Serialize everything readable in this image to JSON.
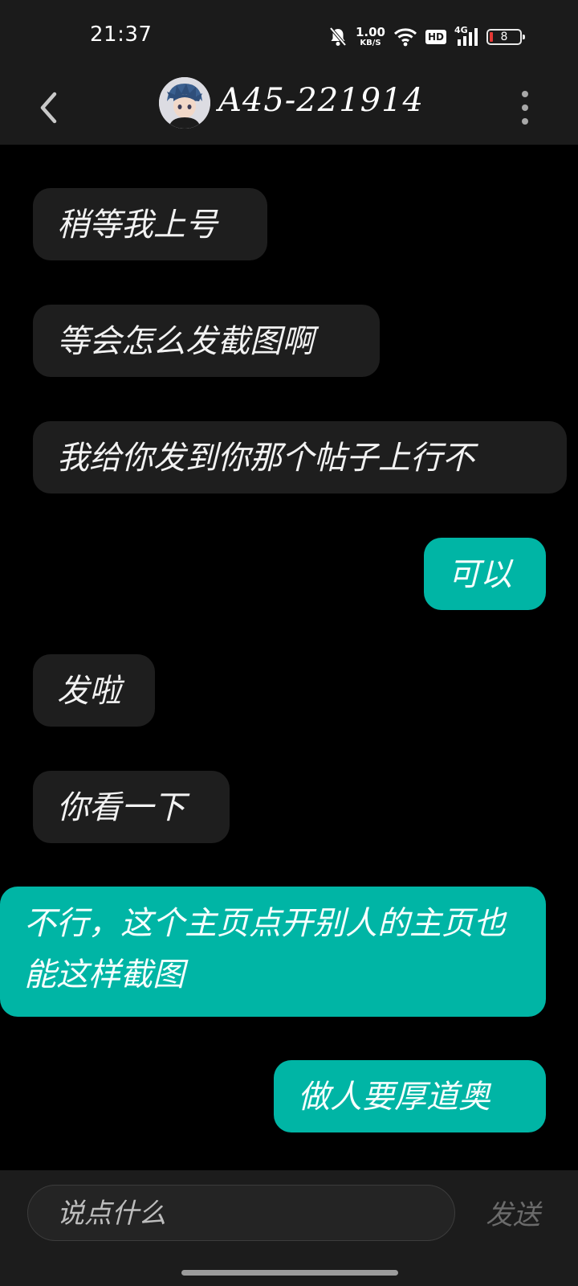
{
  "status_bar": {
    "time": "21:37",
    "net_speed_value": "1.00",
    "net_speed_unit": "KB/S",
    "hd_label": "HD",
    "network_label": "4G",
    "battery_level": "8",
    "icons": [
      "mute-bell-icon",
      "wifi-icon",
      "hd-icon",
      "signal-icon",
      "battery-icon"
    ]
  },
  "header": {
    "title": "A45-221914",
    "back_icon": "chevron-left-icon",
    "more_icon": "vertical-dots-icon"
  },
  "messages": [
    {
      "side": "received",
      "text": "稍等我上号"
    },
    {
      "side": "received",
      "text": "等会怎么发截图啊"
    },
    {
      "side": "received",
      "text": "我给你发到你那个帖子上行不"
    },
    {
      "side": "sent",
      "text": "可以"
    },
    {
      "side": "received",
      "text": "发啦"
    },
    {
      "side": "received",
      "text": "你看一下"
    },
    {
      "side": "sent",
      "text": "不行，这个主页点开别人的主页也能这样截图"
    },
    {
      "side": "sent",
      "text": "做人要厚道奥"
    }
  ],
  "input_bar": {
    "placeholder": "说点什么",
    "send_label": "发送"
  },
  "colors": {
    "background": "#000000",
    "bar": "#1b1b1b",
    "received_bubble": "#1e1e1e",
    "sent_bubble": "#00b5a5",
    "battery_low": "#e53935"
  }
}
